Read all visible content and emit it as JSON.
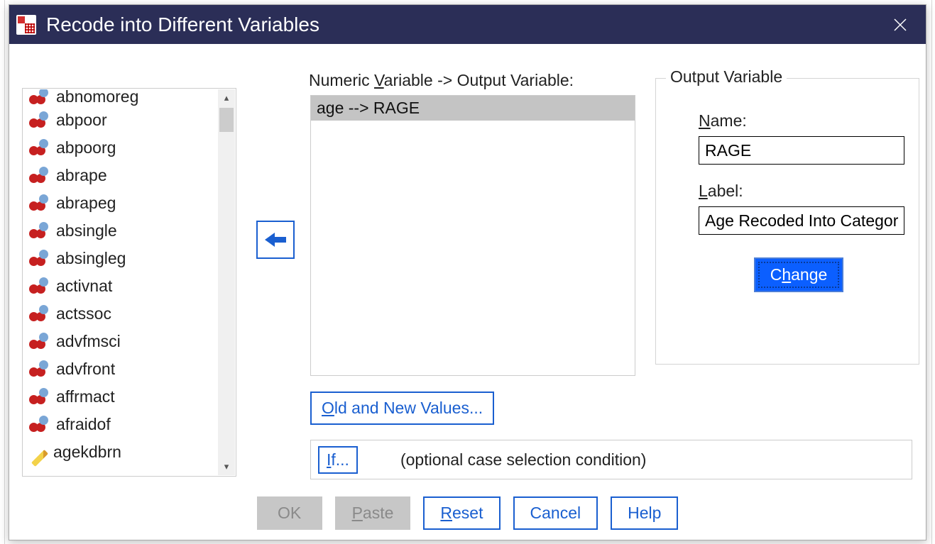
{
  "titlebar": {
    "title": "Recode into Different Variables",
    "close_label": "Close"
  },
  "varlist": {
    "clipped_top": "abnomoreg",
    "items": [
      "abpoor",
      "abpoorg",
      "abrape",
      "abrapeg",
      "absingle",
      "absingleg",
      "activnat",
      "actssoc",
      "advfmsci",
      "advfront",
      "affrmact",
      "afraidof",
      "agekdbrn"
    ]
  },
  "pair": {
    "label_pre": "Numeric ",
    "label_v": "V",
    "label_post": "ariable -> Output Variable:",
    "selected": "age --> RAGE"
  },
  "output": {
    "legend": "Output Variable",
    "name_label_pre": "",
    "name_label_u": "N",
    "name_label_post": "ame:",
    "name_value": "RAGE",
    "label_label_pre": "",
    "label_label_u": "L",
    "label_label_post": "abel:",
    "label_value": "Age Recoded Into Categories",
    "change_pre": "C",
    "change_u": "h",
    "change_post": "ange"
  },
  "oldnew": {
    "pre": "",
    "u": "O",
    "post": "ld and New Values..."
  },
  "ifrow": {
    "btn_pre": "",
    "btn_u": "I",
    "btn_post": "f...",
    "text": "(optional case selection condition)"
  },
  "buttons": {
    "ok": "OK",
    "paste_pre": "",
    "paste_u": "P",
    "paste_post": "aste",
    "reset_pre": "",
    "reset_u": "R",
    "reset_post": "eset",
    "cancel": "Cancel",
    "help": "Help"
  }
}
